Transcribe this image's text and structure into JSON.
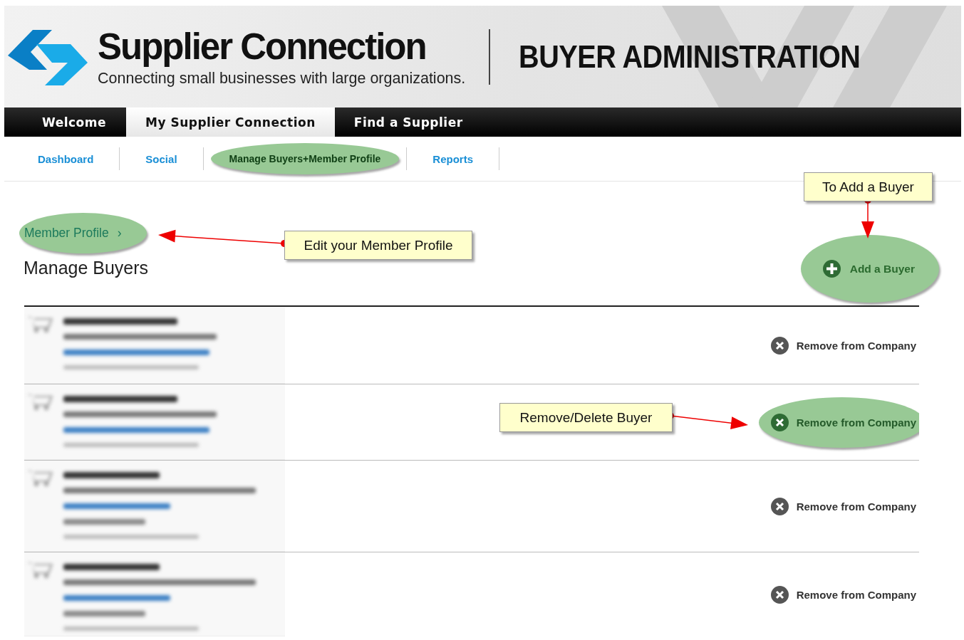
{
  "header": {
    "title": "Supplier Connection",
    "tagline": "Connecting small businesses with large organizations.",
    "section_title": "BUYER ADMINISTRATION"
  },
  "main_tabs": [
    {
      "label": "Welcome",
      "selected": false
    },
    {
      "label": "My Supplier Connection",
      "selected": true
    },
    {
      "label": "Find a Supplier",
      "selected": false
    }
  ],
  "sub_tabs": [
    {
      "label": "Dashboard",
      "highlighted": false
    },
    {
      "label": "Social",
      "highlighted": false
    },
    {
      "label": "Manage Buyers+Member Profile",
      "highlighted": true
    },
    {
      "label": "Reports",
      "highlighted": false
    }
  ],
  "member_profile_link": {
    "label": "Member Profile",
    "chevron": "›",
    "highlighted": true
  },
  "heading": "Manage Buyers",
  "add_button": {
    "label": "Add a Buyer",
    "highlighted": true
  },
  "buyers": [
    {
      "kind": "short",
      "remove_label": "Remove from Company",
      "highlighted": false
    },
    {
      "kind": "short",
      "remove_label": "Remove from Company",
      "highlighted": true
    },
    {
      "kind": "long",
      "remove_label": "Remove from Company",
      "highlighted": false
    },
    {
      "kind": "long",
      "remove_label": "Remove from Company",
      "highlighted": false
    }
  ],
  "callouts": [
    {
      "text": "Edit your Member Profile"
    },
    {
      "text": "To Add a Buyer"
    },
    {
      "text": "Remove/Delete Buyer"
    }
  ]
}
